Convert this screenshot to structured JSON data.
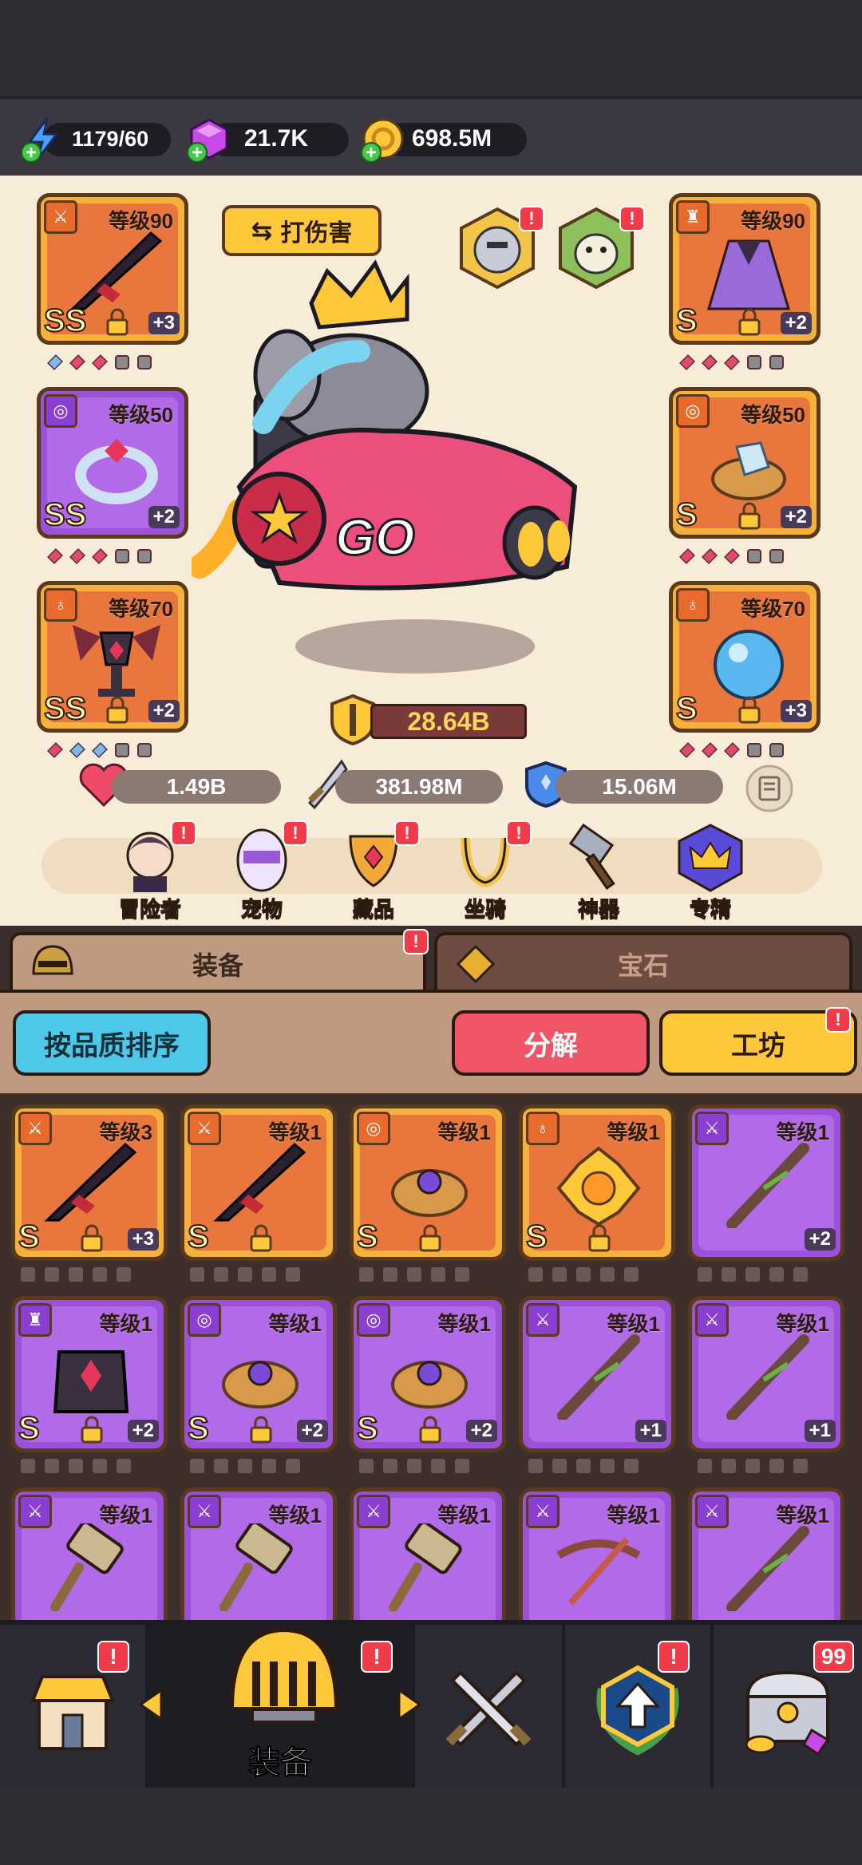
{
  "resources": {
    "energy": "1179/60",
    "gems": "21.7K",
    "gold": "698.5M"
  },
  "equip_slots_left": [
    {
      "level": "等级90",
      "rank": "SS",
      "plus": "+3"
    },
    {
      "level": "等级50",
      "rank": "SS",
      "plus": "+2"
    },
    {
      "level": "等级70",
      "rank": "SS",
      "plus": "+2"
    }
  ],
  "equip_slots_right": [
    {
      "level": "等级90",
      "rank": "S",
      "plus": "+2"
    },
    {
      "level": "等级50",
      "rank": "S",
      "plus": "+2"
    },
    {
      "level": "等级70",
      "rank": "S",
      "plus": "+3"
    }
  ],
  "hero": {
    "damage_button": "打伤害",
    "vehicle_text": "GO",
    "power": "28.64B"
  },
  "stats": {
    "hp": "1.49B",
    "attack": "381.98M",
    "defense": "15.06M"
  },
  "menu": [
    {
      "label": "冒险者",
      "icon": "adventurer-icon"
    },
    {
      "label": "宠物",
      "icon": "pet-egg-icon"
    },
    {
      "label": "藏品",
      "icon": "collection-icon"
    },
    {
      "label": "坐骑",
      "icon": "mount-icon"
    },
    {
      "label": "神器",
      "icon": "artifact-hammer-icon"
    },
    {
      "label": "专精",
      "icon": "mastery-crown-icon"
    }
  ],
  "tabs": {
    "equipment": "装备",
    "gems": "宝石"
  },
  "actions": {
    "sort": "按品质排序",
    "dismantle": "分解",
    "workshop": "工坊"
  },
  "inventory": [
    {
      "level": "等级3",
      "rank": "S",
      "plus": "+3",
      "color": "orange",
      "item": "sword"
    },
    {
      "level": "等级1",
      "rank": "S",
      "plus": "",
      "color": "orange",
      "item": "sword"
    },
    {
      "level": "等级1",
      "rank": "S",
      "plus": "",
      "color": "orange",
      "item": "ring"
    },
    {
      "level": "等级1",
      "rank": "S",
      "plus": "",
      "color": "orange",
      "item": "amulet"
    },
    {
      "level": "等级1",
      "rank": "",
      "plus": "+2",
      "color": "purple",
      "item": "staff"
    },
    {
      "level": "等级1",
      "rank": "S",
      "plus": "+2",
      "color": "purple",
      "item": "armor"
    },
    {
      "level": "等级1",
      "rank": "S",
      "plus": "+2",
      "color": "purple",
      "item": "ring"
    },
    {
      "level": "等级1",
      "rank": "S",
      "plus": "+2",
      "color": "purple",
      "item": "ring"
    },
    {
      "level": "等级1",
      "rank": "",
      "plus": "+1",
      "color": "purple",
      "item": "staff"
    },
    {
      "level": "等级1",
      "rank": "",
      "plus": "+1",
      "color": "purple",
      "item": "staff"
    },
    {
      "level": "等级1",
      "rank": "",
      "plus": "",
      "color": "purple",
      "item": "hammer"
    },
    {
      "level": "等级1",
      "rank": "",
      "plus": "",
      "color": "purple",
      "item": "hammer"
    },
    {
      "level": "等级1",
      "rank": "",
      "plus": "",
      "color": "purple",
      "item": "hammer"
    },
    {
      "level": "等级1",
      "rank": "",
      "plus": "",
      "color": "purple",
      "item": "crossbow"
    },
    {
      "level": "等级1",
      "rank": "",
      "plus": "",
      "color": "purple",
      "item": "staff"
    }
  ],
  "bottom_nav": {
    "equipment_label": "装备",
    "chest_count": "99"
  },
  "colors": {
    "accent_yellow": "#ffc83a",
    "accent_red": "#ef5566",
    "accent_cyan": "#4ec8e8",
    "orange_rarity": "#f6b13a",
    "purple_rarity": "#9b51d8"
  }
}
